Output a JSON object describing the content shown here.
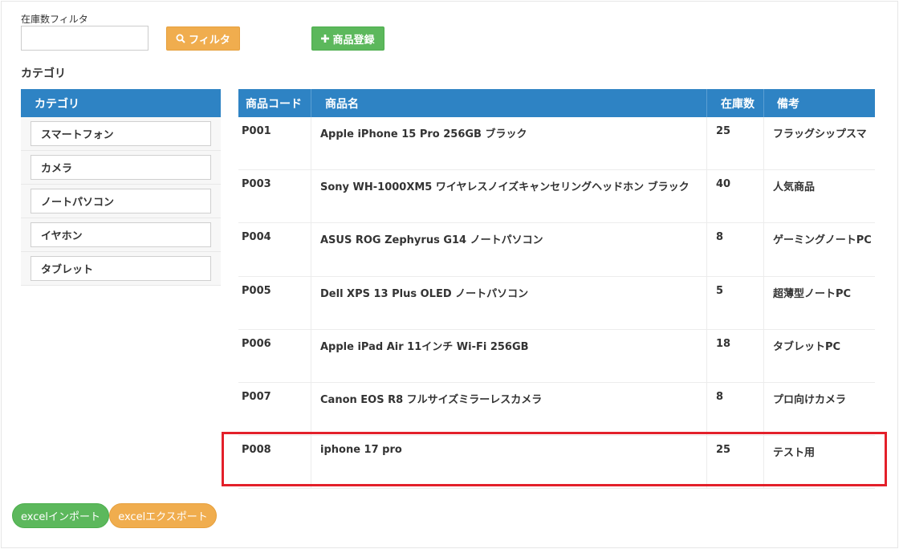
{
  "filter": {
    "label": "在庫数フィルタ",
    "value": "",
    "filter_button": "フィルタ",
    "register_button": "商品登録"
  },
  "categories": {
    "heading": "カテゴリ",
    "panel_title": "カテゴリ",
    "items": [
      {
        "label": "スマートフォン"
      },
      {
        "label": "カメラ"
      },
      {
        "label": "ノートパソコン"
      },
      {
        "label": "イヤホン"
      },
      {
        "label": "タブレット"
      }
    ]
  },
  "table": {
    "columns": [
      "商品コード",
      "商品名",
      "在庫数",
      "備考"
    ],
    "rows": [
      {
        "code": "P001",
        "name": "Apple iPhone 15 Pro 256GB ブラック",
        "stock": "25",
        "note": "フラッグシップスマ"
      },
      {
        "code": "P003",
        "name": "Sony WH-1000XM5 ワイヤレスノイズキャンセリングヘッドホン ブラック",
        "stock": "40",
        "note": "人気商品"
      },
      {
        "code": "P004",
        "name": "ASUS ROG Zephyrus G14 ノートパソコン",
        "stock": "8",
        "note": "ゲーミングノートPC"
      },
      {
        "code": "P005",
        "name": "Dell XPS 13 Plus OLED ノートパソコン",
        "stock": "5",
        "note": "超薄型ノートPC"
      },
      {
        "code": "P006",
        "name": "Apple iPad Air 11インチ Wi-Fi 256GB",
        "stock": "18",
        "note": "タブレットPC"
      },
      {
        "code": "P007",
        "name": "Canon EOS R8 フルサイズミラーレスカメラ",
        "stock": "8",
        "note": "プロ向けカメラ"
      },
      {
        "code": "P008",
        "name": "iphone 17 pro",
        "stock": "25",
        "note": "テスト用"
      }
    ]
  },
  "footer": {
    "import_button": "excelインポート",
    "export_button": "excelエクスポート"
  },
  "colors": {
    "header_blue": "#2e83c4",
    "orange": "#f0ad4e",
    "green": "#5cb85c",
    "highlight_red": "#e3202a"
  },
  "icons": {
    "filter": "search-icon",
    "register": "plus-icon"
  }
}
